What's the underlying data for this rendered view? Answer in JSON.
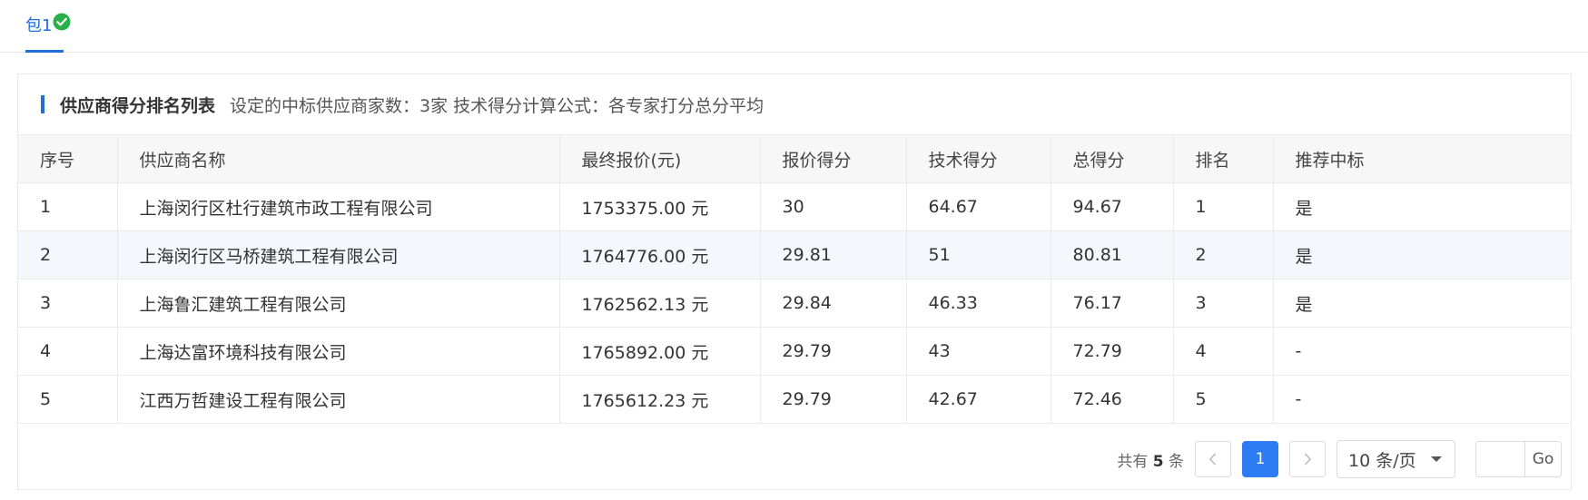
{
  "tabs": [
    {
      "label": "包1",
      "complete": true
    }
  ],
  "colors": {
    "accent": "#1e6fd9",
    "check": "#27b148",
    "active_page": "#2d7cf6"
  },
  "panel": {
    "title": "供应商得分排名列表",
    "subtitle": "设定的中标供应商家数：3家 技术得分计算公式：各专家打分总分平均"
  },
  "table": {
    "columns": [
      "序号",
      "供应商名称",
      "最终报价(元)",
      "报价得分",
      "技术得分",
      "总得分",
      "排名",
      "推荐中标"
    ],
    "rows": [
      [
        "1",
        "上海闵行区杜行建筑市政工程有限公司",
        "1753375.00 元",
        "30",
        "64.67",
        "94.67",
        "1",
        "是"
      ],
      [
        "2",
        "上海闵行区马桥建筑工程有限公司",
        "1764776.00 元",
        "29.81",
        "51",
        "80.81",
        "2",
        "是"
      ],
      [
        "3",
        "上海鲁汇建筑工程有限公司",
        "1762562.13 元",
        "29.84",
        "46.33",
        "76.17",
        "3",
        "是"
      ],
      [
        "4",
        "上海达富环境科技有限公司",
        "1765892.00 元",
        "29.79",
        "43",
        "72.79",
        "4",
        "-"
      ],
      [
        "5",
        "江西万哲建设工程有限公司",
        "1765612.23 元",
        "29.79",
        "42.67",
        "72.46",
        "5",
        "-"
      ]
    ]
  },
  "pagination": {
    "total_prefix": "共有",
    "total": "5",
    "total_suffix": "条",
    "current_page": "1",
    "page_size": "10 条/页",
    "jump_label": "Go",
    "jump_value": ""
  }
}
